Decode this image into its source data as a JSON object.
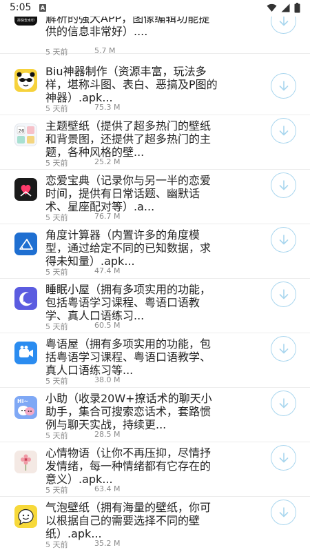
{
  "status_bar": {
    "time": "5:05",
    "notification_glyph": "A"
  },
  "apps": [
    {
      "title": "抖快去水印（专注于短视频去水印解析的强大APP，图像编辑功能提供的信息非常好）....",
      "time": "5 天前",
      "size": "5.7 M",
      "icon": "watermark-app-icon",
      "icon_caption": "抖快去水印"
    },
    {
      "title": "Biu神器制作（资源丰富，玩法多样，堪称斗图、表白、恶搞及P图的神器）.apk...",
      "time": "5 天前",
      "size": "75.3 M",
      "icon": "panda-face-icon"
    },
    {
      "title": "主题壁纸（提供了超多热门的壁纸和背景图，还提供了超多热门的主题，各种风格的壁...",
      "time": "5 天前",
      "size": "25.2 M",
      "icon": "theme-grid-icon"
    },
    {
      "title": "恋爱宝典（记录你与另一半的恋爱时间，提供有日常话题、幽默话术、星座配对等）.a...",
      "time": "5 天前",
      "size": "76.7 M",
      "icon": "heart-hands-icon"
    },
    {
      "title": "角度计算器（内置许多的角度模型，通过给定不同的已知数据，求得未知量）.apk...",
      "time": "5 天前",
      "size": "47.4 M",
      "icon": "angle-icon"
    },
    {
      "title": "睡眠小屋（拥有多项实用的功能，包括粤语学习课程、粤语口语教学、真人口语练习...",
      "time": "5 天前",
      "size": "60.5 M",
      "icon": "moon-sleep-icon"
    },
    {
      "title": "粤语屋（拥有多项实用的功能，包括粤语学习课程、粤语口语教学、真人口语练习等...",
      "time": "5 天前",
      "size": "38.0 M",
      "icon": "video-camera-icon"
    },
    {
      "title": "小助（收录20W+撩话术的聊天小助手，集合可搜索恋话术，套路惯例与聊天实战，持续更...",
      "time": "5 天前",
      "size": "28.5 M",
      "icon": "chat-bubbles-icon",
      "icon_caption": "Hi~"
    },
    {
      "title": "心情物语（让你不再压抑，尽情抒发情绪，每一种情绪都有它存在的意义）.apk...",
      "time": "5 天前",
      "size": "63.4 M",
      "icon": "flower-icon"
    },
    {
      "title": "气泡壁纸（拥有海量的壁纸，你可以根据自己的需要选择不同的壁纸）.apk...",
      "time": "5 天前",
      "size": "35.2 M",
      "icon": "smiley-bubble-icon"
    }
  ],
  "colors": {
    "download_ring": "#a9d6ee",
    "meta_text": "#8a8a8a"
  }
}
